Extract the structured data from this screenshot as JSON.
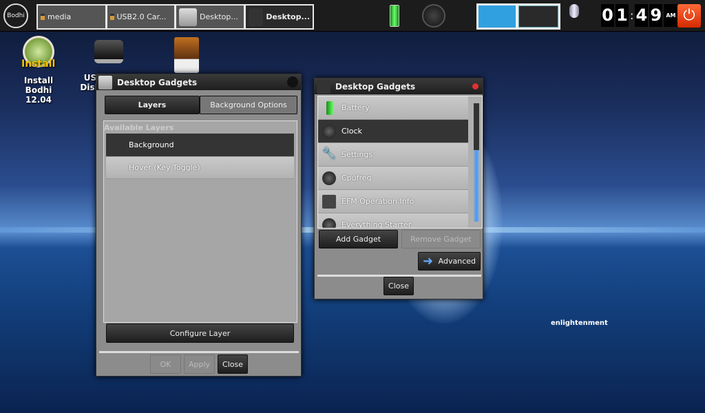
{
  "panel": {
    "start_label": "Bodhi",
    "tasks": [
      {
        "label": "media"
      },
      {
        "label": "USB2.0 Car..."
      },
      {
        "label": "Desktop..."
      },
      {
        "label": "Desktop..."
      }
    ],
    "clock": {
      "h1": "0",
      "h2": "1",
      "sep": ":",
      "m1": "4",
      "m2": "9",
      "ampm": "AM"
    }
  },
  "desktop": {
    "icons": [
      {
        "label": "Install Bodhi 12.04",
        "logo_text": "Install"
      },
      {
        "label": "US Disk"
      }
    ],
    "brand": "enlightenment"
  },
  "left_window": {
    "title": "Desktop Gadgets",
    "tabs": [
      "Layers",
      "Background Options"
    ],
    "list_header": "Available Layers",
    "layers": [
      "Background",
      "Hover (Key Toggle)"
    ],
    "configure": "Configure Layer",
    "ok": "OK",
    "apply": "Apply",
    "close": "Close"
  },
  "right_window": {
    "title": "Desktop Gadgets",
    "gadgets": [
      "Battery",
      "Clock",
      "Settings",
      "Cpufreq",
      "EFM Operation Info",
      "Everything Starter"
    ],
    "add": "Add Gadget",
    "remove": "Remove Gadget",
    "advanced": "Advanced",
    "close": "Close"
  },
  "colors": {
    "accent": "#31a0e0",
    "power": "#e8401a"
  }
}
